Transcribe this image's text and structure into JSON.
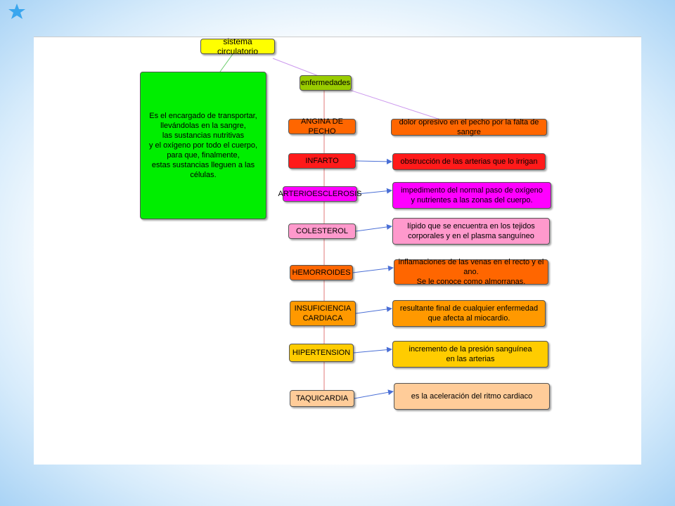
{
  "colors": {
    "root": "#ffff00",
    "definition": "#00ee00",
    "category": "#99cc00",
    "orange_dark": "#ff6600",
    "red": "#ff1a1a",
    "magenta": "#ff00ff",
    "pink": "#ff99cc",
    "orange": "#ff9900",
    "amber": "#ffcc00",
    "peach": "#ffcc99",
    "arrow": "#4a6fd6"
  },
  "root": {
    "label": "sistema circulatorio"
  },
  "definition": {
    "text": "Es el encargado de transportar,\nllevándolas en la sangre,\nlas sustancias nutritivas\ny el oxígeno por todo el cuerpo,\npara que, finalmente,\nestas sustancias lleguen a las células."
  },
  "category": {
    "label": "enfermedades"
  },
  "diseases": [
    {
      "name": "ANGINA DE PECHO",
      "description": "dolor opresivo en el pecho por la falta de sangre"
    },
    {
      "name": "INFARTO",
      "description": "obstrucción de las arterias que lo irrigan"
    },
    {
      "name": "ARTERIOESCLEROSIS",
      "description": "impedimento del normal paso de oxígeno\ny nutrientes a las zonas del cuerpo."
    },
    {
      "name": "COLESTEROL",
      "description": "lípido que se encuentra en los tejidos\ncorporales y en el plasma sanguíneo"
    },
    {
      "name": "HEMORROIDES",
      "description": "inflamaciones de las venas en el recto y el ano.\nSe le conoce como almorranas."
    },
    {
      "name": "INSUFICIENCIA\nCARDIACA",
      "description": "resultante final de cualquier enfermedad\nque afecta al miocardio."
    },
    {
      "name": "HIPERTENSION",
      "description": "incremento de la presión sanguínea\nen las arterias"
    },
    {
      "name": "TAQUICARDIA",
      "description": "es la aceleración del ritmo cardiaco"
    }
  ]
}
